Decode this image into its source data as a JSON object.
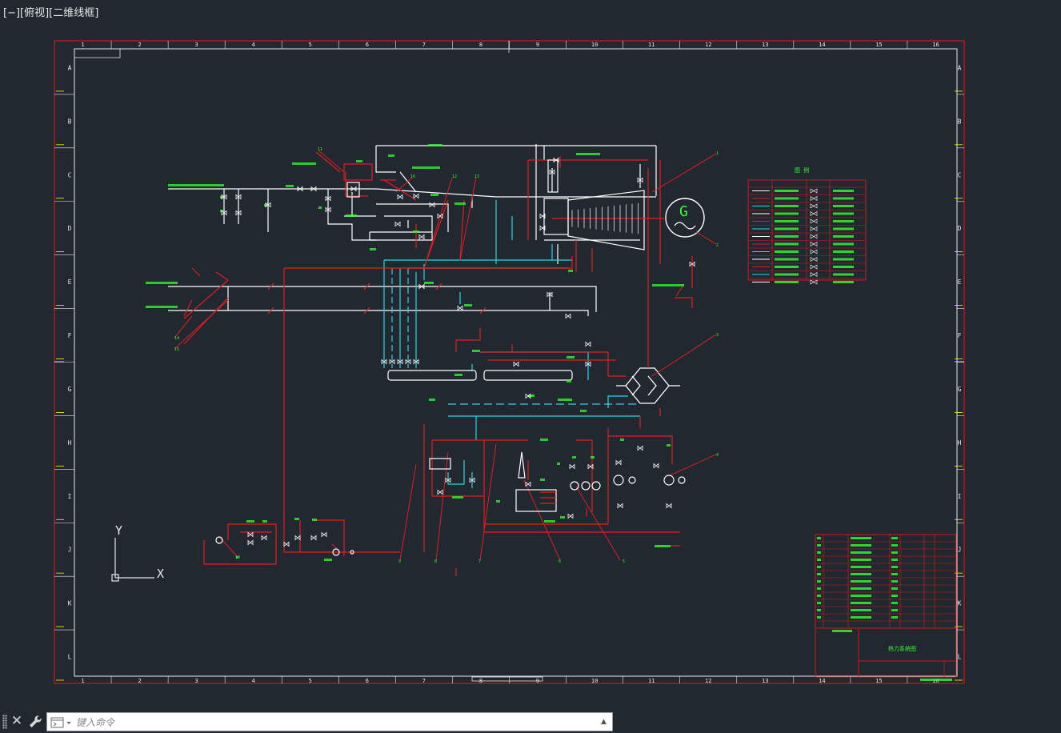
{
  "viewport": {
    "label": "[−][俯视][二维线框]"
  },
  "frame": {
    "columns": [
      "1",
      "2",
      "3",
      "4",
      "5",
      "6",
      "7",
      "8",
      "9",
      "10",
      "11",
      "12",
      "13",
      "14",
      "15",
      "16"
    ],
    "rows": [
      "A",
      "B",
      "C",
      "D",
      "E",
      "F",
      "G",
      "H",
      "I",
      "J",
      "K",
      "L"
    ]
  },
  "drawing": {
    "generator_label": "G",
    "legend_title": "图 例",
    "title_block_name": "热力系统图",
    "ucs": {
      "x": "X",
      "y": "Y"
    },
    "callouts": [
      "1",
      "2",
      "3",
      "4",
      "5",
      "6",
      "7",
      "8",
      "9",
      "10",
      "11",
      "12",
      "13",
      "14",
      "15",
      "16"
    ]
  },
  "colors": {
    "background": "#212830",
    "frame": "#cc1a1a",
    "steam_line": "#ffffff",
    "water_line": "#2ad4e6",
    "annotation": "#33ff33",
    "pipe_red": "#e01e1e",
    "grid_mark": "#ffff00"
  },
  "command_line": {
    "placeholder": "键入命令",
    "close_icon": "close-icon",
    "customize_icon": "wrench-icon",
    "prompt_icon": "command-prompt-icon"
  }
}
